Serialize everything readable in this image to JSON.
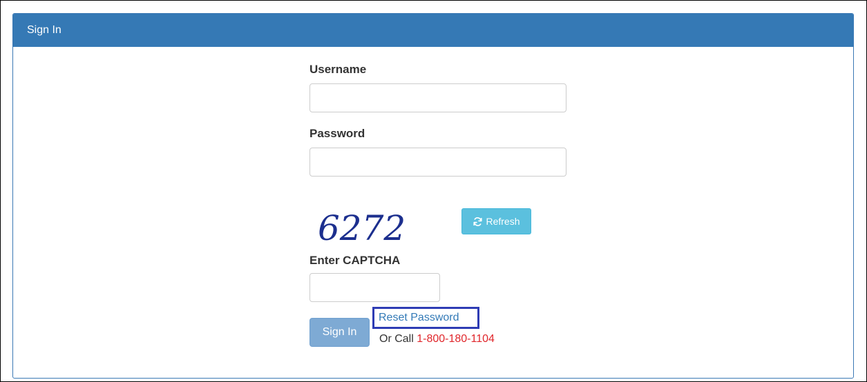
{
  "panel": {
    "title": "Sign In",
    "heading_color": "#3579b5"
  },
  "form": {
    "username_label": "Username",
    "username_value": "",
    "password_label": "Password",
    "password_value": "",
    "captcha_image_text": "6272",
    "refresh_label": "Refresh",
    "refresh_icon": "refresh-icon",
    "captcha_label": "Enter CAPTCHA",
    "captcha_value": "",
    "signin_label": "Sign In",
    "reset_label": "Reset Password",
    "call_prefix": "Or Call",
    "phone": "1-800-180-1104"
  },
  "colors": {
    "primary": "#3579b5",
    "info": "#5bc0de",
    "link": "#337ab7",
    "phone": "#e0262b",
    "highlight": "#2e3cb4"
  }
}
